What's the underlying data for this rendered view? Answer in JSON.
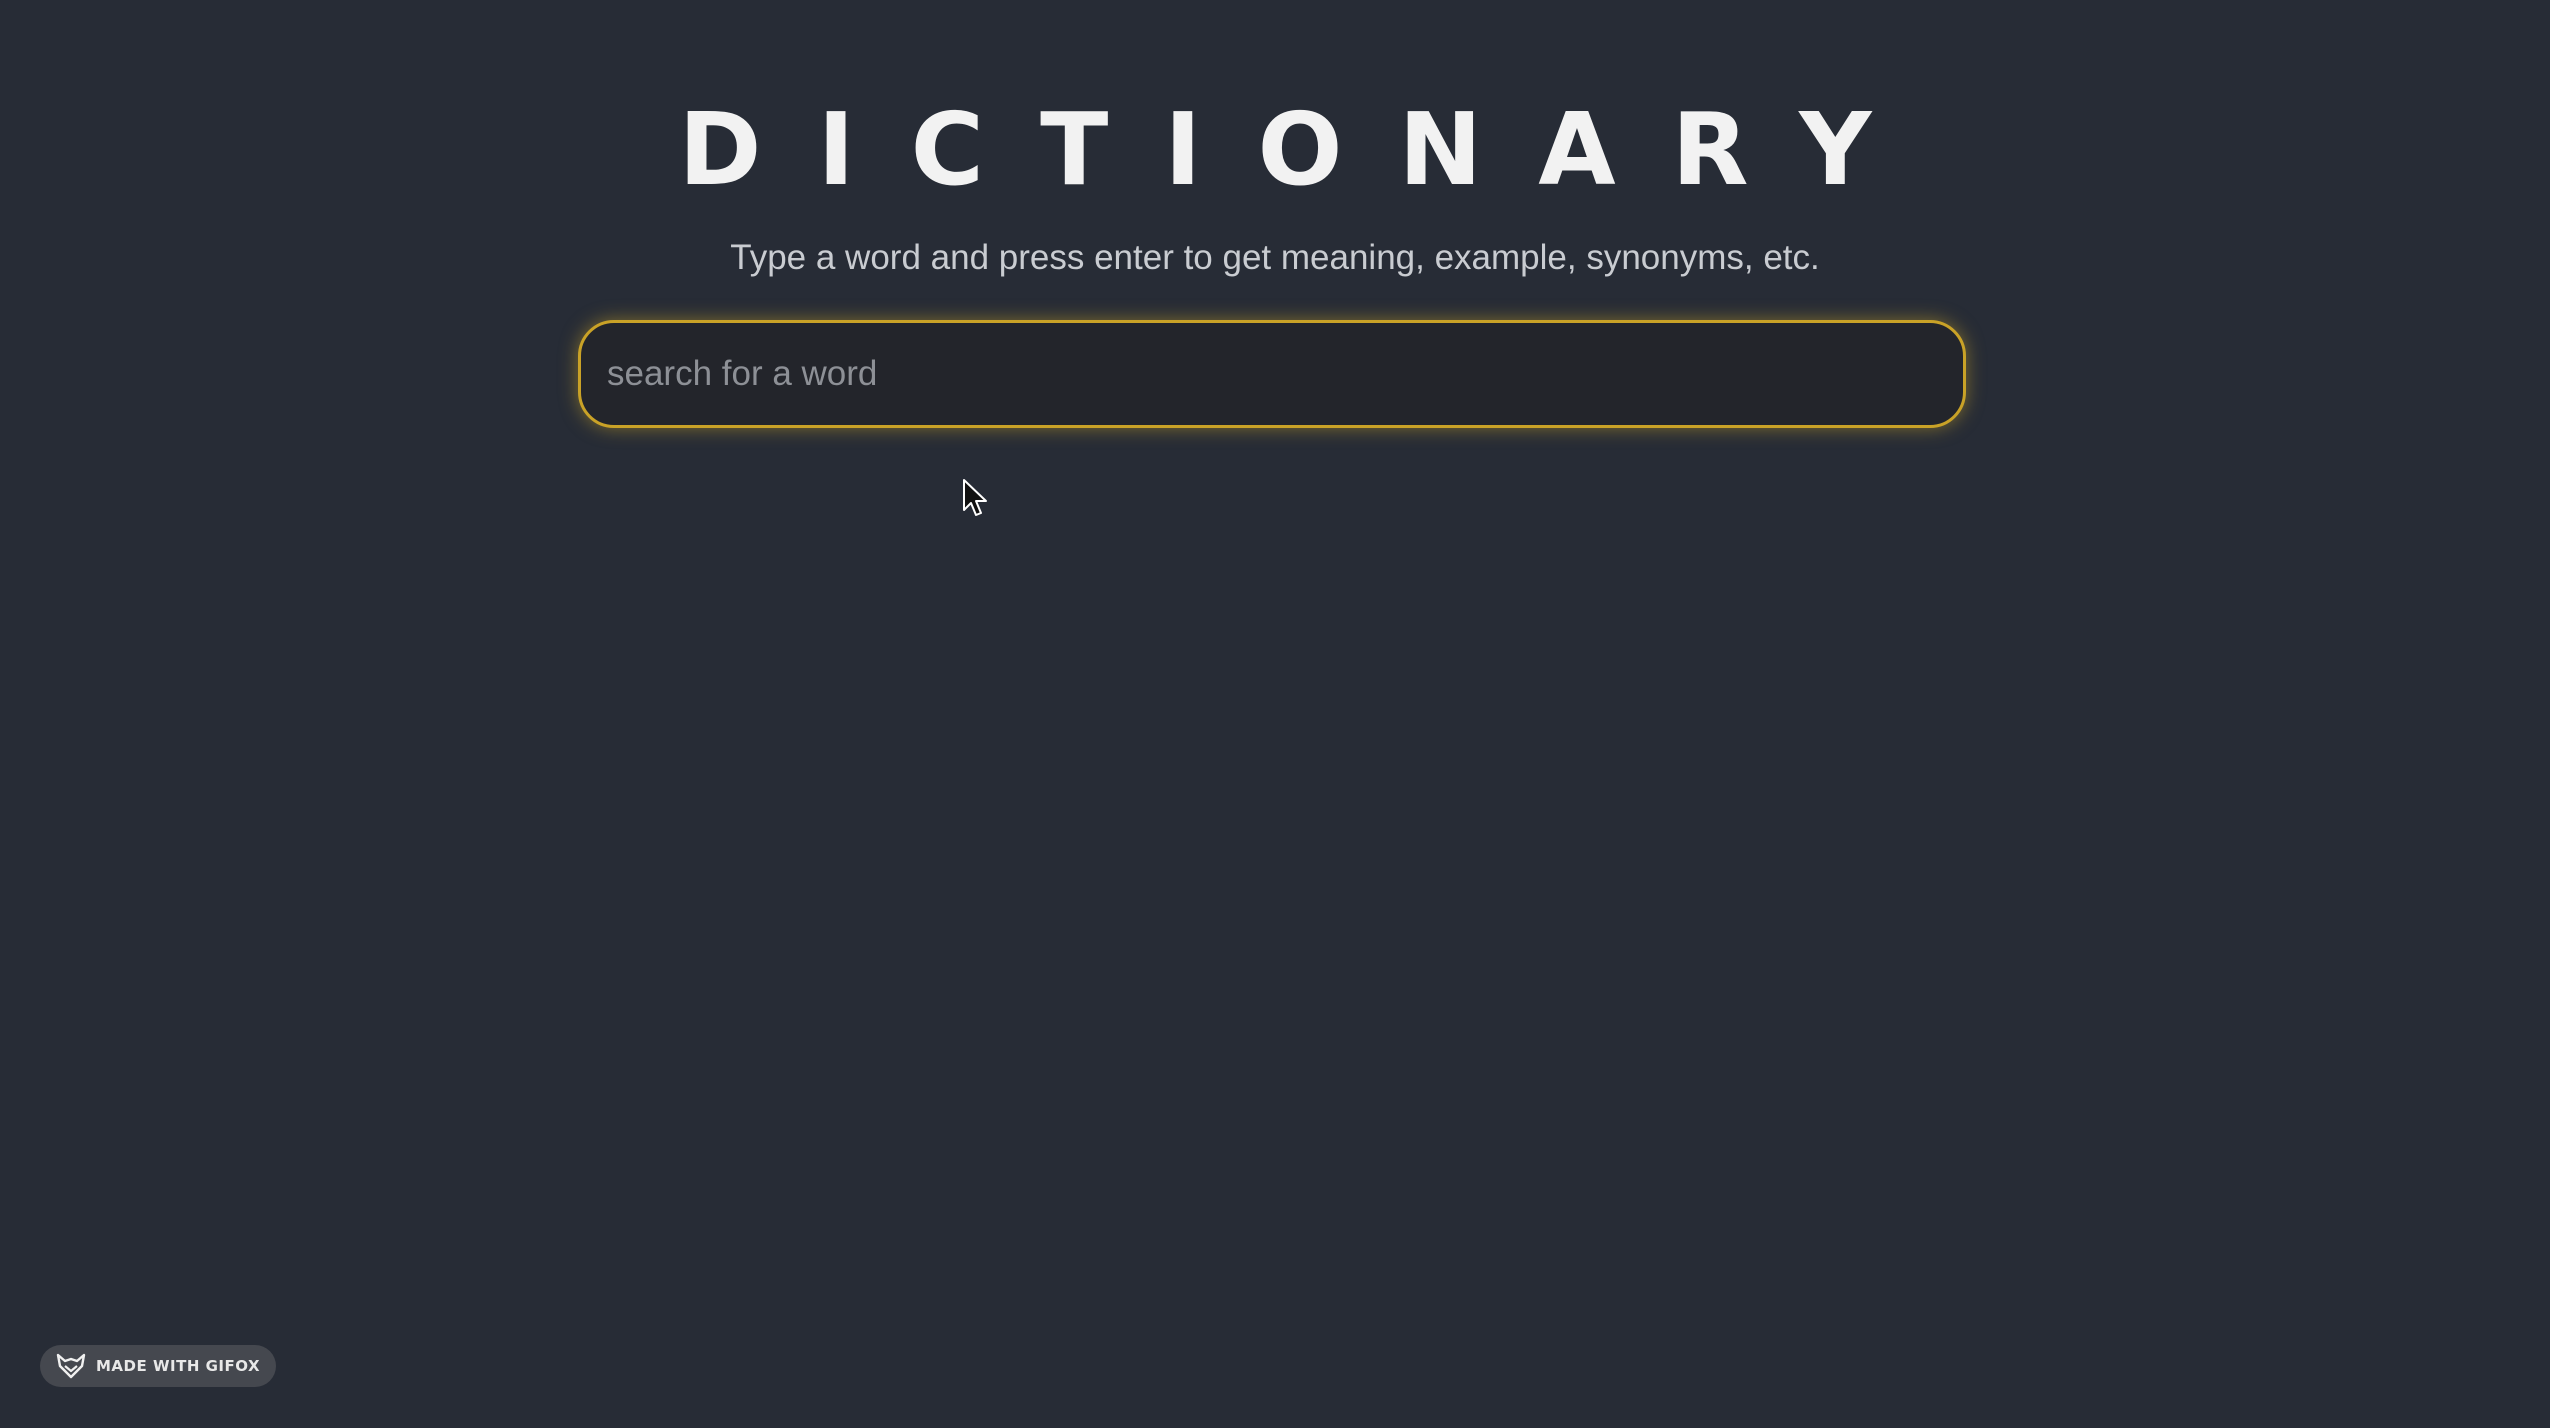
{
  "header": {
    "title": "DICTIONARY",
    "subtitle": "Type a word and press enter to get meaning, example, synonyms, etc."
  },
  "search": {
    "value": "",
    "placeholder": "search for a word",
    "accent_color": "#c9a227"
  },
  "watermark": {
    "icon": "fox-icon",
    "label": "MADE WITH GIFOX"
  },
  "theme": {
    "background": "#272c36",
    "field_background": "#23252b"
  }
}
